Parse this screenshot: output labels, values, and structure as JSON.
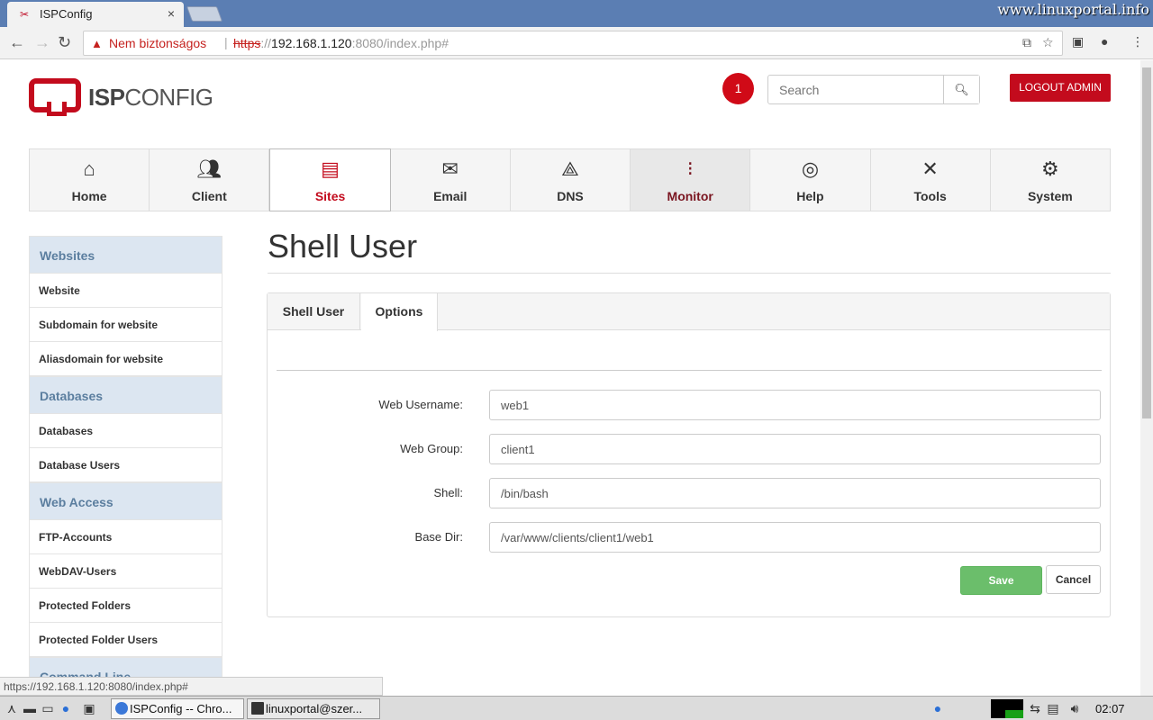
{
  "browser": {
    "tab_title": "ISPConfig",
    "tab_close": "×",
    "watermark": "www.linuxportal.info",
    "security_label": "Nem biztonságos",
    "url_scheme": "https",
    "url_sep": "://",
    "url_host": "192.168.1.120",
    "url_rest": ":8080/index.php#",
    "status_url": "https://192.168.1.120:8080/index.php#"
  },
  "header": {
    "logo_bold": "ISP",
    "logo_rest": "CONFIG",
    "notification_count": "1",
    "search_placeholder": "Search",
    "logout_label": "LOGOUT ADMIN"
  },
  "mainnav": [
    {
      "label": "Home",
      "icon": "home-icon"
    },
    {
      "label": "Client",
      "icon": "client-icon"
    },
    {
      "label": "Sites",
      "icon": "sites-icon"
    },
    {
      "label": "Email",
      "icon": "email-icon"
    },
    {
      "label": "DNS",
      "icon": "dns-icon"
    },
    {
      "label": "Monitor",
      "icon": "traffic-light-icon"
    },
    {
      "label": "Help",
      "icon": "lifebuoy-icon"
    },
    {
      "label": "Tools",
      "icon": "tools-icon"
    },
    {
      "label": "System",
      "icon": "gear-icon"
    }
  ],
  "sidebar": {
    "sections": [
      {
        "title": "Websites",
        "items": [
          "Website",
          "Subdomain for website",
          "Aliasdomain for website"
        ]
      },
      {
        "title": "Databases",
        "items": [
          "Databases",
          "Database Users"
        ]
      },
      {
        "title": "Web Access",
        "items": [
          "FTP-Accounts",
          "WebDAV-Users",
          "Protected Folders",
          "Protected Folder Users"
        ]
      },
      {
        "title": "Command Line",
        "items": []
      }
    ]
  },
  "main": {
    "title": "Shell User",
    "tabs": [
      "Shell User",
      "Options"
    ],
    "fields": [
      {
        "label": "Web Username:",
        "value": "web1"
      },
      {
        "label": "Web Group:",
        "value": "client1"
      },
      {
        "label": "Shell:",
        "value": "/bin/bash"
      },
      {
        "label": "Base Dir:",
        "value": "/var/www/clients/client1/web1"
      }
    ],
    "save_label": "Save",
    "cancel_label": "Cancel"
  },
  "taskbar": {
    "task1": "ISPConfig -- Chro...",
    "task2": "linuxportal@szer...",
    "clock": "02:07"
  }
}
